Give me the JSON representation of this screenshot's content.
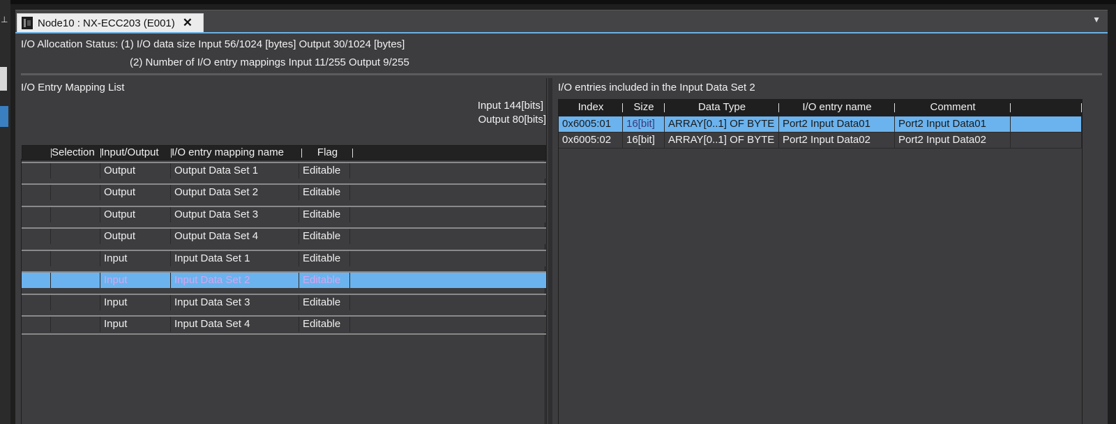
{
  "tab": {
    "title": "Node10 : NX-ECC203 (E001)",
    "close": "✕"
  },
  "status": {
    "line1": "I/O Allocation Status: (1) I/O data size Input 56/1024 [bytes] Output 30/1024 [bytes]",
    "line2": "(2) Number of I/O entry mappings Input 11/255 Output 9/255"
  },
  "mapping_list": {
    "title": "I/O Entry Mapping List",
    "input_bits": "Input 144[bits]",
    "output_bits": "Output 80[bits]",
    "columns": [
      "",
      "Selection",
      "Input/Output",
      "I/O entry mapping name",
      "Flag"
    ],
    "rows": [
      {
        "io": "Output",
        "name": "Output Data Set 1",
        "flag": "Editable"
      },
      {
        "io": "Output",
        "name": "Output Data Set 2",
        "flag": "Editable"
      },
      {
        "io": "Output",
        "name": "Output Data Set 3",
        "flag": "Editable"
      },
      {
        "io": "Output",
        "name": "Output Data Set 4",
        "flag": "Editable"
      },
      {
        "io": "Input",
        "name": "Input Data Set 1",
        "flag": "Editable"
      },
      {
        "io": "Input",
        "name": "Input Data Set 2",
        "flag": "Editable"
      },
      {
        "io": "Input",
        "name": "Input Data Set 3",
        "flag": "Editable"
      },
      {
        "io": "Input",
        "name": "Input Data Set 4",
        "flag": "Editable"
      }
    ],
    "selected_row": 5
  },
  "entries": {
    "title": "I/O entries included in the Input Data Set 2",
    "columns": [
      "Index",
      "Size",
      "Data Type",
      "I/O entry name",
      "Comment"
    ],
    "rows": [
      {
        "index": "0x6005:01",
        "size": "16[bit]",
        "type": "ARRAY[0..1] OF BYTE",
        "name": "Port2 Input Data01",
        "comment": "Port2 Input Data01"
      },
      {
        "index": "0x6005:02",
        "size": "16[bit]",
        "type": "ARRAY[0..1] OF BYTE",
        "name": "Port2 Input Data02",
        "comment": "Port2 Input Data02"
      }
    ],
    "selected_row": 0
  },
  "colors": {
    "selection": "#6bb3ee",
    "panel_bg": "#3d3d40",
    "tab_accent": "#6ab1e6"
  }
}
